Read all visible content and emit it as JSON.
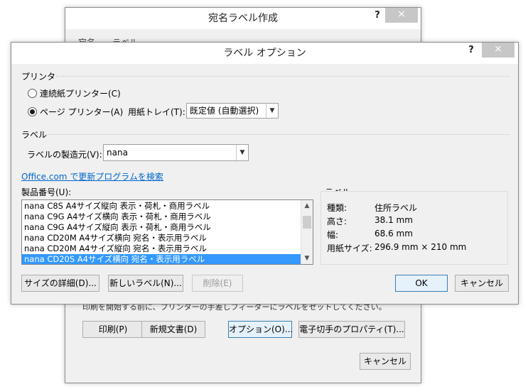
{
  "background_dialog": {
    "title": "宛名ラベル作成",
    "help": "?",
    "close": "×",
    "tabs": [
      "宛名",
      "ラベル"
    ],
    "instruction": "印刷を開始する前に、プリンターの手差しフィーダーにラベルをセットしてください。",
    "buttons": {
      "print": "印刷(P)",
      "new_document": "新規文書(D)",
      "options": "オプション(O)...",
      "e_postage": "電子切手のプロパティ(T)...",
      "cancel": "キャンセル"
    }
  },
  "dialog": {
    "title": "ラベル オプション",
    "help": "?",
    "close": "×",
    "printer_section": "プリンター",
    "continuous_printer": "連続紙プリンター(C)",
    "page_printer": "ページ プリンター(A)",
    "tray_label": "用紙トレイ(T):",
    "tray_value": "既定値 (自動選択)",
    "label_section": "ラベル",
    "vendor_label": "ラベルの製造元(V):",
    "vendor_value": "nana",
    "update_link": "Office.com で更新プログラムを検索",
    "product_label": "製品番号(U):",
    "products": [
      "nana C8S A4サイズ縦向 表示・荷札・商用ラベル",
      "nana C9G A4サイズ横向 表示・荷札・商用ラベル",
      "nana C9G A4サイズ縦向 表示・荷札・商用ラベル",
      "nana CD20M A4サイズ横向 宛名・表示用ラベル",
      "nana CD20M A4サイズ縦向 宛名・表示用ラベル",
      "nana CD20S A4サイズ横向 宛名・表示用ラベル"
    ],
    "selected_index": 5,
    "info_section": "ラベル",
    "info": [
      {
        "key": "種類:",
        "value": "住所ラベル"
      },
      {
        "key": "高さ:",
        "value": "38.1 mm"
      },
      {
        "key": "幅:",
        "value": "68.6 mm"
      },
      {
        "key": "用紙サイズ:",
        "value": "296.9 mm × 210 mm"
      }
    ],
    "buttons": {
      "details": "サイズの詳細(D)...",
      "new_label": "新しいラベル(N)...",
      "delete": "削除(E)",
      "ok": "OK",
      "cancel": "キャンセル"
    }
  }
}
